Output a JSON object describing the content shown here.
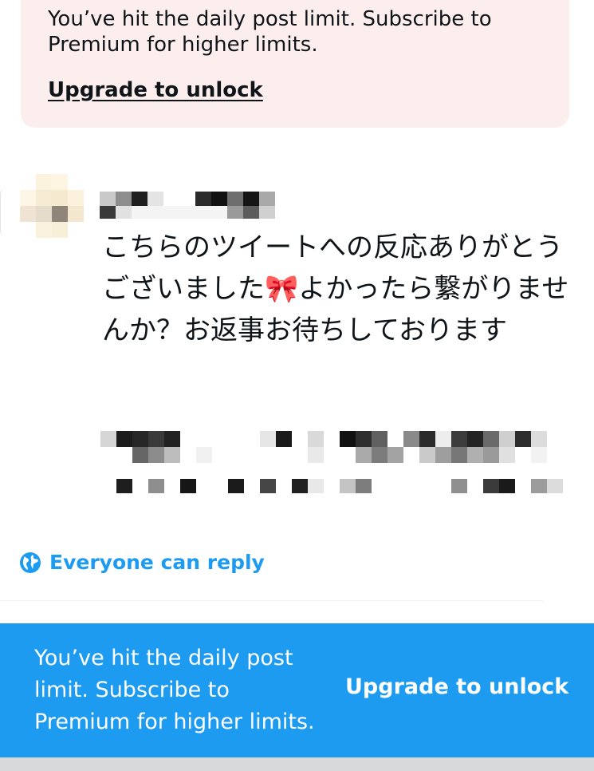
{
  "top_notice": {
    "message": "You’ve hit the daily post limit. Subscribe to Premium for higher limits.",
    "link_label": "Upgrade to unlock"
  },
  "tweet": {
    "body": "こちらのツイートへの反応ありがとうございました🎀よかったら繋がりませんか？お返事お待ちしております"
  },
  "reply_setting": {
    "icon": "globe-icon",
    "label": "Everyone can reply"
  },
  "bottom_banner": {
    "message": "You’ve hit the daily post limit. Subscribe to Premium for higher limits.",
    "link_label": "Upgrade to unlock"
  },
  "colors": {
    "accent": "#1d9bf0",
    "notice_bg": "#fdeeee",
    "text": "#0f1419"
  }
}
